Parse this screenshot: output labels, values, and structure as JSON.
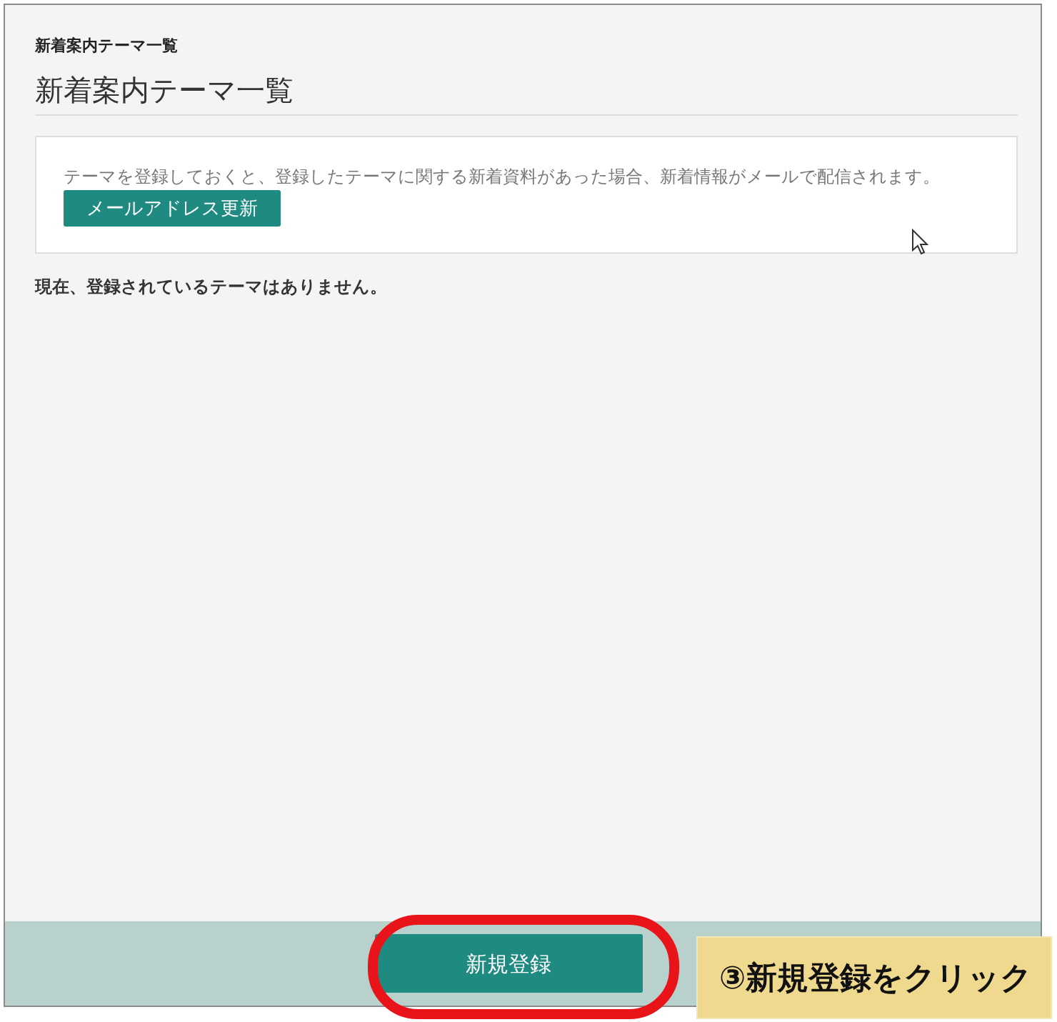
{
  "breadcrumb": "新着案内テーマ一覧",
  "title": "新着案内テーマ一覧",
  "info": {
    "text": "テーマを登録しておくと、登録したテーマに関する新着資料があった場合、新着情報がメールで配信されます。",
    "button": "メールアドレス更新"
  },
  "message": "現在、登録されているテーマはありません。",
  "footer": {
    "button": "新規登録"
  },
  "annotation": {
    "text": "③新規登録をクリック"
  }
}
